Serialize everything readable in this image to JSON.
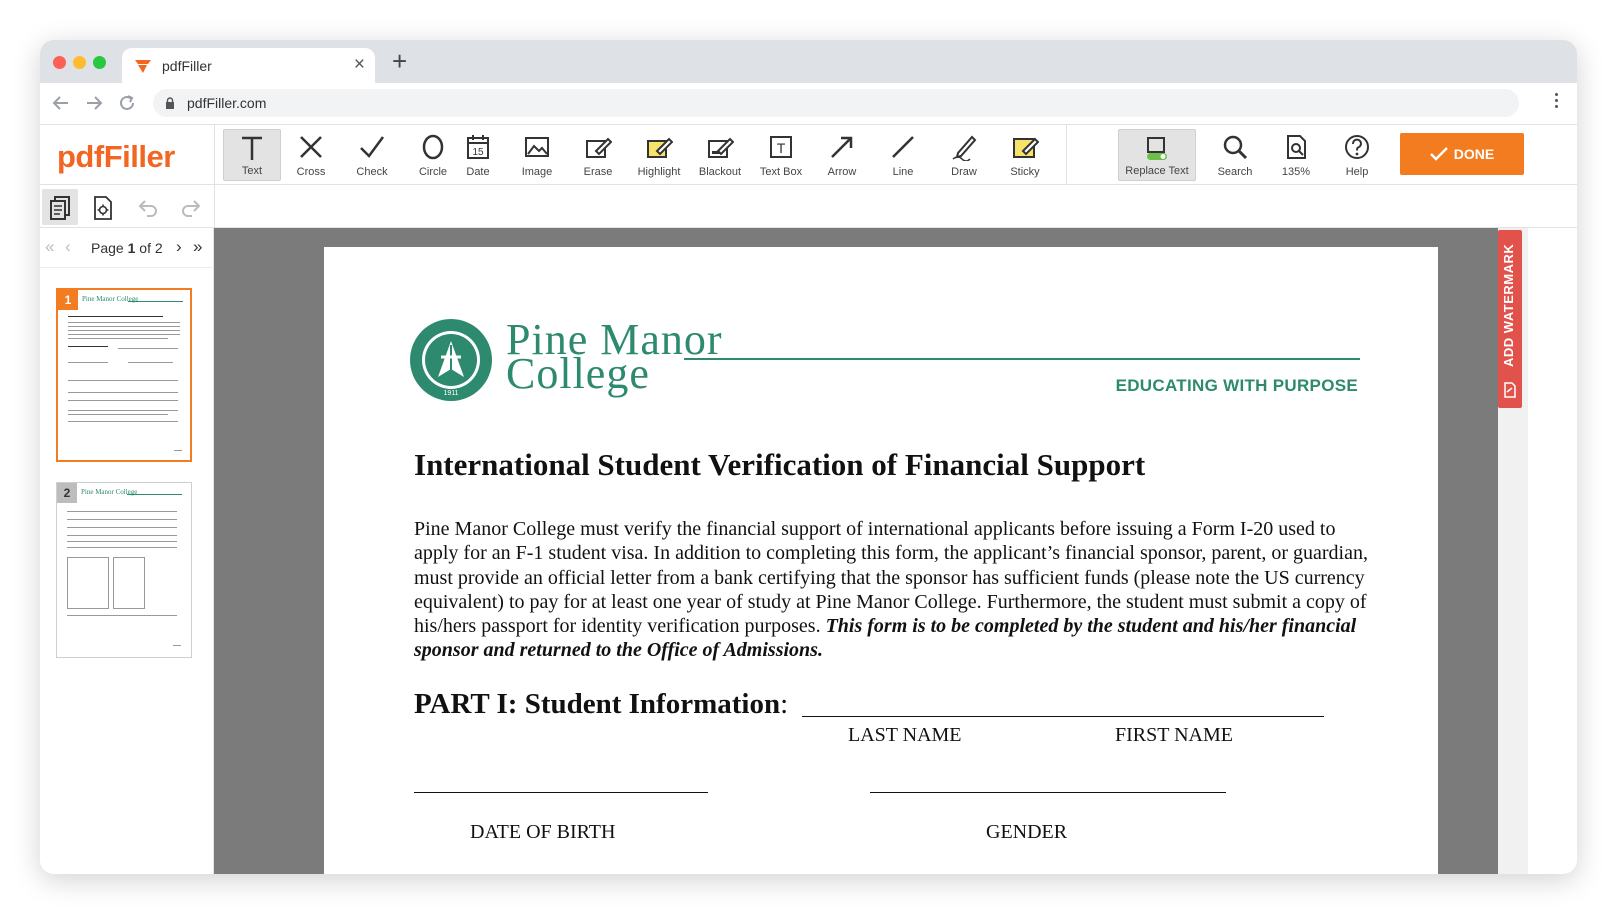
{
  "browser": {
    "tab_title": "pdfFiller",
    "url": "pdfFiller.com",
    "new_tab_label": "+",
    "close_tab_label": "×"
  },
  "app": {
    "brand": "pdfFiller",
    "tools": [
      {
        "label": "Text",
        "icon": "text-icon"
      },
      {
        "label": "Cross",
        "icon": "cross-icon"
      },
      {
        "label": "Check",
        "icon": "check-icon"
      },
      {
        "label": "Circle",
        "icon": "circle-icon"
      },
      {
        "label": "Date",
        "icon": "calendar-icon"
      },
      {
        "label": "Image",
        "icon": "image-icon"
      },
      {
        "label": "Erase",
        "icon": "eraser-icon"
      },
      {
        "label": "Highlight",
        "icon": "highlighter-icon"
      },
      {
        "label": "Blackout",
        "icon": "blackout-icon"
      },
      {
        "label": "Text Box",
        "icon": "textbox-icon"
      },
      {
        "label": "Arrow",
        "icon": "arrow-icon"
      },
      {
        "label": "Line",
        "icon": "line-icon"
      },
      {
        "label": "Draw",
        "icon": "pen-icon"
      },
      {
        "label": "Sticky",
        "icon": "sticky-note-icon"
      }
    ],
    "date_icon_number": "15",
    "textbox_icon_letter": "T",
    "right_tools": [
      {
        "label": "Replace Text",
        "icon": "replace-text-icon"
      },
      {
        "label": "Search",
        "icon": "search-icon"
      },
      {
        "label": "135%",
        "icon": "zoom-icon"
      },
      {
        "label": "Help",
        "icon": "help-icon"
      }
    ],
    "done_label": "DONE",
    "colors": {
      "brand": "#f26522",
      "done": "#f47c20",
      "college_green": "#2d8a6e",
      "watermark": "#e0524a"
    }
  },
  "pager": {
    "page_prefix": "Page ",
    "current": "1",
    "of_text": " of 2"
  },
  "thumbnails": [
    {
      "num": "1",
      "logo": "Pine Manor College",
      "selected": true
    },
    {
      "num": "2",
      "logo": "Pine Manor College",
      "selected": false
    }
  ],
  "watermark_label": "ADD WATERMARK",
  "document": {
    "college_line1": "Pine Manor",
    "college_line2": "College",
    "seal_text": "SIGILLUM PINEAE MANORIS COLLEGII",
    "seal_year": "1911",
    "motto": "EDUCATING WITH PURPOSE",
    "title": "International Student Verification of Financial Support",
    "body_plain": "Pine Manor College must verify the financial support of international applicants before issuing a Form I-20 used to apply for an F-1 student visa. In addition to completing this form, the applicant’s financial sponsor, parent, or guardian, must provide an official letter from a bank certifying that the sponsor has sufficient funds (please note the US currency equivalent) to pay for at least one year of study at Pine Manor College. Furthermore, the student must submit a copy of his/hers passport for identity verification purposes. ",
    "body_emphasis": "This form is to be completed by the student and his/her financial sponsor and returned to the Office of Admissions.",
    "part1_heading": "PART I: Student Information",
    "part1_colon": ":",
    "fields": {
      "last_name": "LAST NAME",
      "first_name": "FIRST NAME",
      "date_of_birth": "DATE OF BIRTH",
      "gender": "GENDER"
    }
  }
}
